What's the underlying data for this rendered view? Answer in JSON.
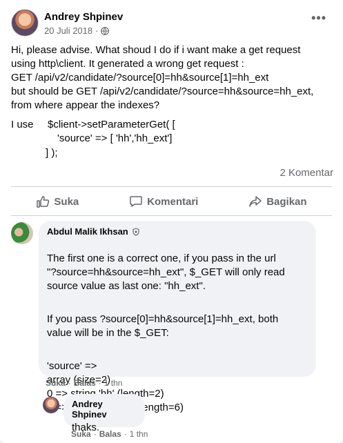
{
  "post": {
    "author": "Andrey Shpinev",
    "date": "20 Juli 2018",
    "separator": "·",
    "paragraph": [
      "Hi, please advise. What shoud I do if i want make a get request",
      "using http\\client. It generated a wrong get request :",
      "GET /api/v2/candidate/?source[0]=hh&source[1]=hh_ext",
      "but should be GET /api/v2/candidate/?source=hh&source=hh_ext,",
      "from where appear the indexes?"
    ],
    "code_label": "I use",
    "code_lines": [
      "$client->setParameterGet( [",
      "'source' => [ 'hh','hh_ext']",
      "] );"
    ],
    "comments_count": "2 Komentar"
  },
  "actions": {
    "like": "Suka",
    "comment": "Komentari",
    "share": "Bagikan"
  },
  "comments": [
    {
      "author": "Abdul Malik Ikhsan",
      "paragraphs": [
        "The first one is a correct one, if you pass in the url\n\"?source=hh&source=hh_ext\", $_GET will only read\nsource value as last one: \"hh_ext\".",
        "If you pass ?source[0]=hh&source[1]=hh_ext, both\nvalue will be in the $_GET:",
        "'source' =>\narray (size=2)\n0 => string 'hh' (length=2)\n1 => string 'hh_ext' (length=6)"
      ],
      "like": "Suka",
      "reply": "Balas",
      "time": "1 thn"
    },
    {
      "author": "Andrey Shpinev",
      "text": "thaks.",
      "like": "Suka",
      "reply": "Balas",
      "time": "1 thn"
    }
  ],
  "icons": {
    "privacy": "globe-icon",
    "more": "more-horizontal-icon",
    "like": "thumbs-up-icon",
    "comment": "speech-bubble-icon",
    "share": "share-arrow-icon",
    "badge": "shield-icon"
  },
  "colors": {
    "text": "#050505",
    "secondary": "#65676b",
    "bubble": "#f0f2f5",
    "divider": "#ced0d4"
  }
}
